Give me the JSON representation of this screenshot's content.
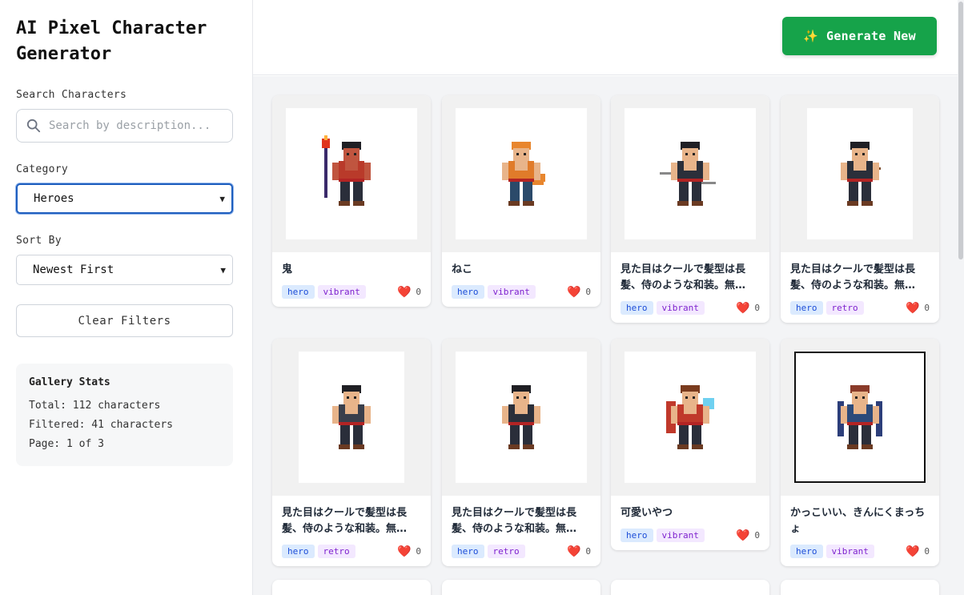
{
  "app": {
    "title": "AI Pixel Character Generator"
  },
  "filters": {
    "search_label": "Search Characters",
    "search_placeholder": "Search by description...",
    "category_label": "Category",
    "category_value": "Heroes",
    "sort_label": "Sort By",
    "sort_value": "Newest First",
    "clear_label": "Clear Filters"
  },
  "stats": {
    "title": "Gallery Stats",
    "total": "Total: 112 characters",
    "filtered": "Filtered: 41 characters",
    "page": "Page: 1 of 3"
  },
  "header": {
    "generate_label": "Generate New",
    "generate_icon": "sparkles-icon"
  },
  "cards": [
    {
      "title": "鬼",
      "tags": [
        "hero",
        "vibrant"
      ],
      "likes": "0",
      "palette": "#b93a2a"
    },
    {
      "title": "ねこ",
      "tags": [
        "hero",
        "vibrant"
      ],
      "likes": "0",
      "palette": "#e07b2a"
    },
    {
      "title": "見た目はクールで髪型は長髪、侍のような和装。無…",
      "tags": [
        "hero",
        "vibrant"
      ],
      "likes": "0",
      "palette": "#2b2f3a"
    },
    {
      "title": "見た目はクールで髪型は長髪、侍のような和装。無…",
      "tags": [
        "hero",
        "retro"
      ],
      "likes": "0",
      "palette": "#2b2f3a"
    },
    {
      "title": "見た目はクールで髪型は長髪、侍のような和装。無…",
      "tags": [
        "hero",
        "retro"
      ],
      "likes": "0",
      "palette": "#3a3f4c"
    },
    {
      "title": "見た目はクールで髪型は長髪、侍のような和装。無…",
      "tags": [
        "hero",
        "retro"
      ],
      "likes": "0",
      "palette": "#2b2f3a"
    },
    {
      "title": "可愛いやつ",
      "tags": [
        "hero",
        "vibrant"
      ],
      "likes": "0",
      "palette": "#c0392b"
    },
    {
      "title": "かっこいい、きんにくまっちょ",
      "tags": [
        "hero",
        "vibrant"
      ],
      "likes": "0",
      "palette": "#2c4a7a"
    }
  ]
}
